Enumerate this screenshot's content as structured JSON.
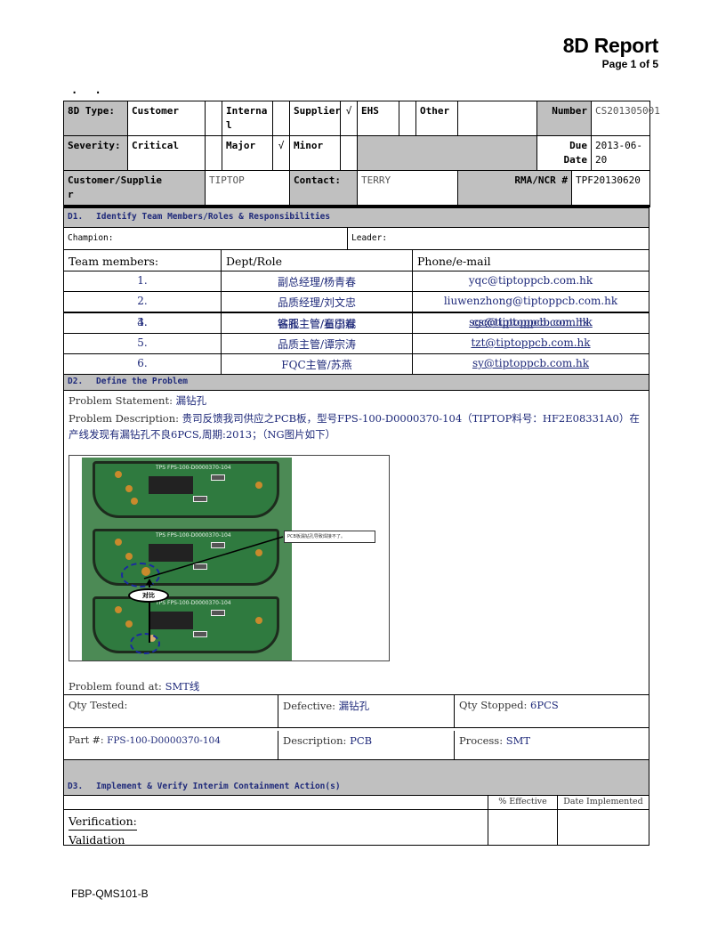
{
  "header": {
    "title": "8D Report",
    "page": "Page 1 of 5",
    "dots": ". ."
  },
  "info": {
    "type_label": "8D Type:",
    "types": [
      {
        "label": "Customer",
        "checked": ""
      },
      {
        "label": "Interna l",
        "checked": ""
      },
      {
        "label": "Supplier",
        "checked": "√"
      },
      {
        "label": "EHS",
        "checked": ""
      },
      {
        "label": "Other",
        "checked": ""
      }
    ],
    "number_label": "Number",
    "number_value": "CS201305001",
    "severity_label": "Severity:",
    "severities": [
      {
        "label": "Critical",
        "checked": ""
      },
      {
        "label": "Major",
        "checked": "√"
      },
      {
        "label": "Minor",
        "checked": ""
      }
    ],
    "due_label": "Due Date",
    "due_value": "2013-06-20",
    "customer_label": "Customer/Supplie r",
    "customer_value": "TIPTOP",
    "contact_label": "Contact:",
    "contact_value": "TERRY",
    "rma_label": "RMA/NCR #",
    "rma_value": "TPF20130620"
  },
  "d1": {
    "num": "D1.",
    "title": "Identify Team Members/Roles & Responsibilities",
    "champion_label": "Champion:",
    "leader_label": "Leader:",
    "headers": [
      "Team members:",
      "Dept/Role",
      "Phone/e-mail"
    ],
    "members": [
      {
        "no": "1.",
        "role": "副总经理/杨青春",
        "email": "yqc@tiptoppcb.com.hk",
        "link": false
      },
      {
        "no": "2.",
        "role": "品质经理/刘文忠",
        "email": "liuwenzhong@tiptoppcb.com.hk",
        "link": false
      },
      {
        "no": "3.",
        "role": "钻孔主管/石国春",
        "email": "sgc@tiptoppcb.com.hk",
        "link": true
      },
      {
        "no": "4.",
        "role": "客服主管/童小斌",
        "email": "cs@tiptoppcb.com.hk",
        "link": true
      },
      {
        "no": "5.",
        "role": "品质主管/谭宗涛",
        "email": "tzt@tiptoppcb.com.hk",
        "link": true
      },
      {
        "no": "6.",
        "role": "FQC主管/苏燕",
        "email": "sy@tiptoppcb.com.hk",
        "link": true
      }
    ]
  },
  "d2": {
    "num": "D2.",
    "title": "Define the Problem",
    "statement_label": "Problem Statement: ",
    "statement_value": "漏钻孔",
    "description_label": "Problem Description: ",
    "description_value": "贵司反馈我司供应之PCB板，型号FPS-100-D0000370-104（TIPTOP料号：HF2E08331A0）在产线发现有漏钻孔不良6PCS,周期:2013；（NG图片如下）",
    "photo": {
      "board_label": "TPS FPS-100-D0000370-104",
      "callout": "PCB板漏钻孔导致焊接不了。",
      "compare": "对比"
    },
    "found_label": "Problem found at: ",
    "found_value": "SMT线",
    "qty_tested_label": "Qty Tested:",
    "qty_tested_value": "",
    "defective_label": "Defective: ",
    "defective_value": "漏钻孔",
    "qty_stopped_label": "Qty Stopped: ",
    "qty_stopped_value": "6PCS",
    "part_label": "Part #: ",
    "part_value": "FPS-100-D0000370-104",
    "desc_label": "Description: ",
    "desc_value": "PCB",
    "process_label": "Process: ",
    "process_value": "SMT"
  },
  "d3": {
    "num": "D3.",
    "title": "Implement & Verify Interim Containment Action(s)",
    "effective_label": "% Effective",
    "date_label": "Date Implemented",
    "verification": "Verification:",
    "validation": "Validation"
  },
  "footer": {
    "code": "FBP-QMS101-B"
  }
}
